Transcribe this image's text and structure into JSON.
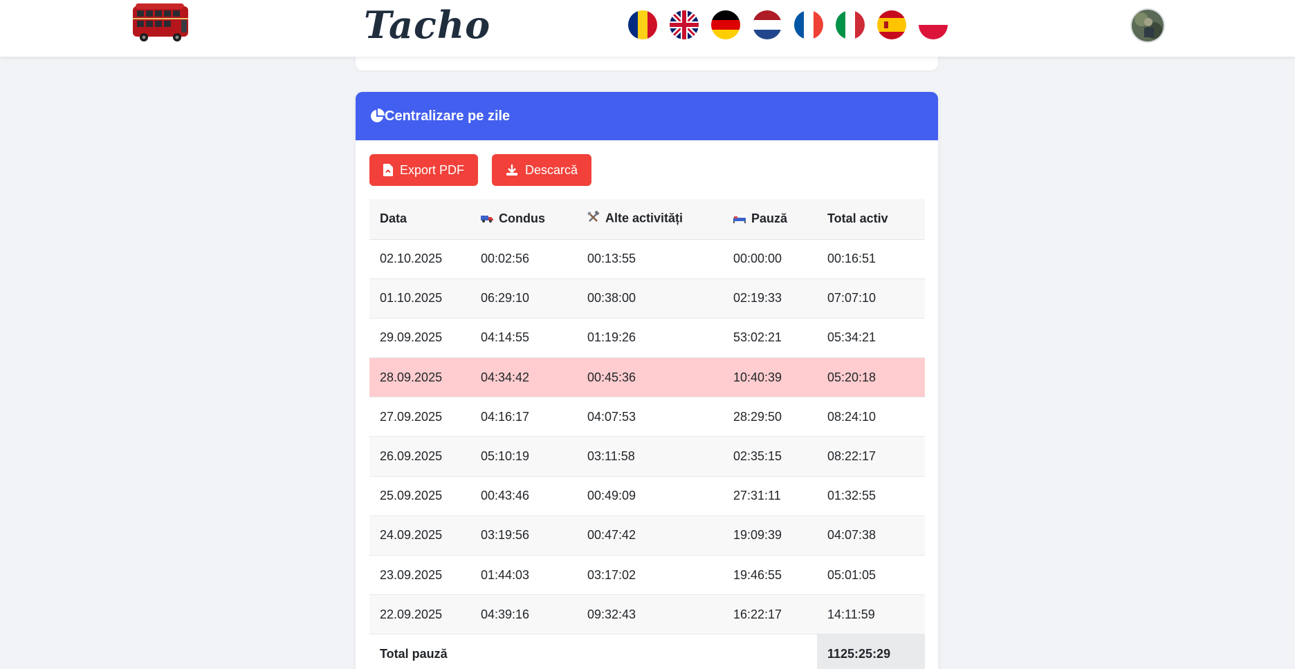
{
  "header": {
    "brand": "Tacho",
    "flags": [
      {
        "name": "romania-flag"
      },
      {
        "name": "uk-flag"
      },
      {
        "name": "germany-flag"
      },
      {
        "name": "netherlands-flag"
      },
      {
        "name": "france-flag"
      },
      {
        "name": "italy-flag"
      },
      {
        "name": "spain-flag"
      },
      {
        "name": "poland-flag"
      }
    ]
  },
  "card": {
    "title": "Centralizare pe zile",
    "export_pdf_label": "Export PDF",
    "download_label": "Descarcă",
    "columns": {
      "date": "Data",
      "driving": "Condus",
      "other": "Alte activități",
      "pause": "Pauză",
      "total": "Total activ"
    },
    "rows": [
      {
        "date": "02.10.2025",
        "driving": "00:02:56",
        "other": "00:13:55",
        "pause": "00:00:00",
        "total": "00:16:51"
      },
      {
        "date": "01.10.2025",
        "driving": "06:29:10",
        "other": "00:38:00",
        "pause": "02:19:33",
        "total": "07:07:10"
      },
      {
        "date": "29.09.2025",
        "driving": "04:14:55",
        "other": "01:19:26",
        "pause": "53:02:21",
        "total": "05:34:21"
      },
      {
        "date": "28.09.2025",
        "driving": "04:34:42",
        "other": "00:45:36",
        "pause": "10:40:39",
        "total": "05:20:18"
      },
      {
        "date": "27.09.2025",
        "driving": "04:16:17",
        "other": "04:07:53",
        "pause": "28:29:50",
        "total": "08:24:10"
      },
      {
        "date": "26.09.2025",
        "driving": "05:10:19",
        "other": "03:11:58",
        "pause": "02:35:15",
        "total": "08:22:17"
      },
      {
        "date": "25.09.2025",
        "driving": "00:43:46",
        "other": "00:49:09",
        "pause": "27:31:11",
        "total": "01:32:55"
      },
      {
        "date": "24.09.2025",
        "driving": "03:19:56",
        "other": "00:47:42",
        "pause": "19:09:39",
        "total": "04:07:38"
      },
      {
        "date": "23.09.2025",
        "driving": "01:44:03",
        "other": "03:17:02",
        "pause": "19:46:55",
        "total": "05:01:05"
      },
      {
        "date": "22.09.2025",
        "driving": "04:39:16",
        "other": "09:32:43",
        "pause": "16:22:17",
        "total": "14:11:59"
      }
    ],
    "footer_label": "Total pauză",
    "footer_value": "1125:25:29",
    "highlight_color": "#ffcdcf"
  }
}
